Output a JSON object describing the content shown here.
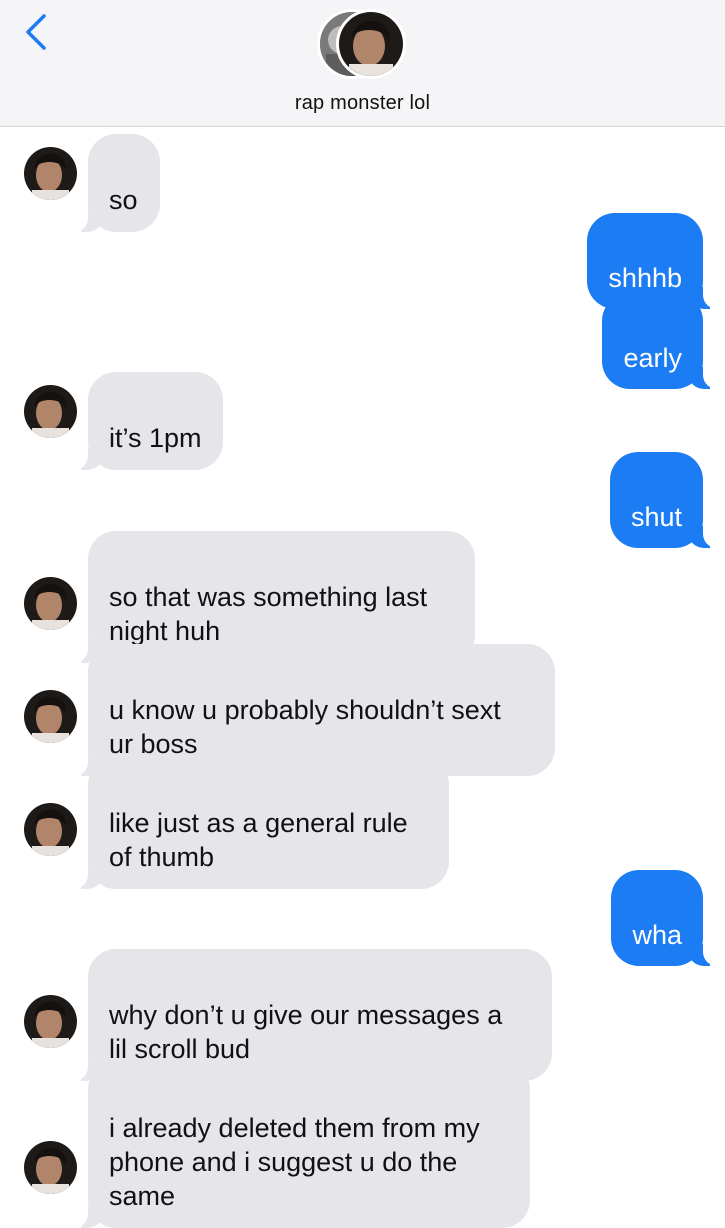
{
  "header": {
    "contact_name": "rap monster lol",
    "back_icon": "chevron-left-icon",
    "accent": "#1c7cf4"
  },
  "colors": {
    "incoming_bubble": "#e5e5ea",
    "outgoing_bubble": "#1c7cf4"
  },
  "messages": [
    {
      "dir": "in",
      "text": "so"
    },
    {
      "dir": "out",
      "text": "shhhb"
    },
    {
      "dir": "out",
      "text": "early"
    },
    {
      "dir": "in",
      "text": "it’s 1pm"
    },
    {
      "dir": "out",
      "text": "shut"
    },
    {
      "dir": "in",
      "text": "so that was something last\nnight huh"
    },
    {
      "dir": "in",
      "text": "u know u probably shouldn’t sext\nur boss"
    },
    {
      "dir": "in",
      "text": "like just as a general rule\nof thumb"
    },
    {
      "dir": "out",
      "text": "wha"
    },
    {
      "dir": "in",
      "text": "why don’t u give our messages a\nlil scroll bud"
    },
    {
      "dir": "in",
      "text": "i already deleted them from my\nphone and i suggest u do the\nsame"
    }
  ]
}
